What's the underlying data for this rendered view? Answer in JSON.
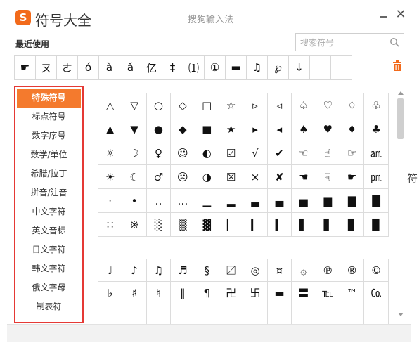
{
  "app": {
    "logo_letter": "S",
    "title": "符号大全",
    "center_title": "搜狗输入法",
    "close_glyph": "✕"
  },
  "recent": {
    "label": "最近使用",
    "symbols": [
      "☛",
      "ㄡ",
      "ㄜ",
      "ó",
      "à",
      "ǎ",
      "亿",
      "‡",
      "⑴",
      "①",
      "▬",
      "♫",
      "℘",
      "↓",
      "",
      ""
    ]
  },
  "search": {
    "placeholder": "搜索符号"
  },
  "categories": [
    {
      "label": "特殊符号",
      "active": true
    },
    {
      "label": "标点符号",
      "active": false
    },
    {
      "label": "数字序号",
      "active": false
    },
    {
      "label": "数学/单位",
      "active": false
    },
    {
      "label": "希腊/拉丁",
      "active": false
    },
    {
      "label": "拼音/注音",
      "active": false
    },
    {
      "label": "中文字符",
      "active": false
    },
    {
      "label": "英文音标",
      "active": false
    },
    {
      "label": "日文字符",
      "active": false
    },
    {
      "label": "韩文字符",
      "active": false
    },
    {
      "label": "俄文字母",
      "active": false
    },
    {
      "label": "制表符",
      "active": false
    }
  ],
  "grid_a": [
    [
      "△",
      "▽",
      "○",
      "◇",
      "□",
      "☆",
      "▹",
      "◃",
      "♤",
      "♡",
      "♢",
      "♧"
    ],
    [
      "▲",
      "▼",
      "●",
      "◆",
      "■",
      "★",
      "▸",
      "◂",
      "♠",
      "♥",
      "♦",
      "♣"
    ],
    [
      "☼",
      "☽",
      "♀",
      "☺",
      "◐",
      "☑",
      "√",
      "✔",
      "☜",
      "☝",
      "☞",
      "㏂"
    ],
    [
      "☀",
      "☾",
      "♂",
      "☹",
      "◑",
      "☒",
      "×",
      "✘",
      "☚",
      "☟",
      "☛",
      "㏘"
    ],
    [
      "·",
      "•",
      "‥",
      "…",
      "▁",
      "▂",
      "▃",
      "▄",
      "▅",
      "▆",
      "▇",
      "█"
    ],
    [
      "∷",
      "※",
      "░",
      "▒",
      "▓",
      "▏",
      "▎",
      "▍",
      "▌",
      "▋",
      "▊",
      "▉"
    ]
  ],
  "grid_b": [
    [
      "♩",
      "♪",
      "♫",
      "♬",
      "§",
      "〼",
      "◎",
      "¤",
      "۞",
      "℗",
      "®",
      "©"
    ],
    [
      "♭",
      "♯",
      "♮",
      "‖",
      "¶",
      "卍",
      "卐",
      "▬",
      "〓",
      "℡",
      "™",
      "㏇"
    ],
    [
      "",
      "",
      "",
      "",
      "",
      "",
      "",
      "",
      "",
      "",
      "",
      ""
    ]
  ],
  "side_char": "符"
}
